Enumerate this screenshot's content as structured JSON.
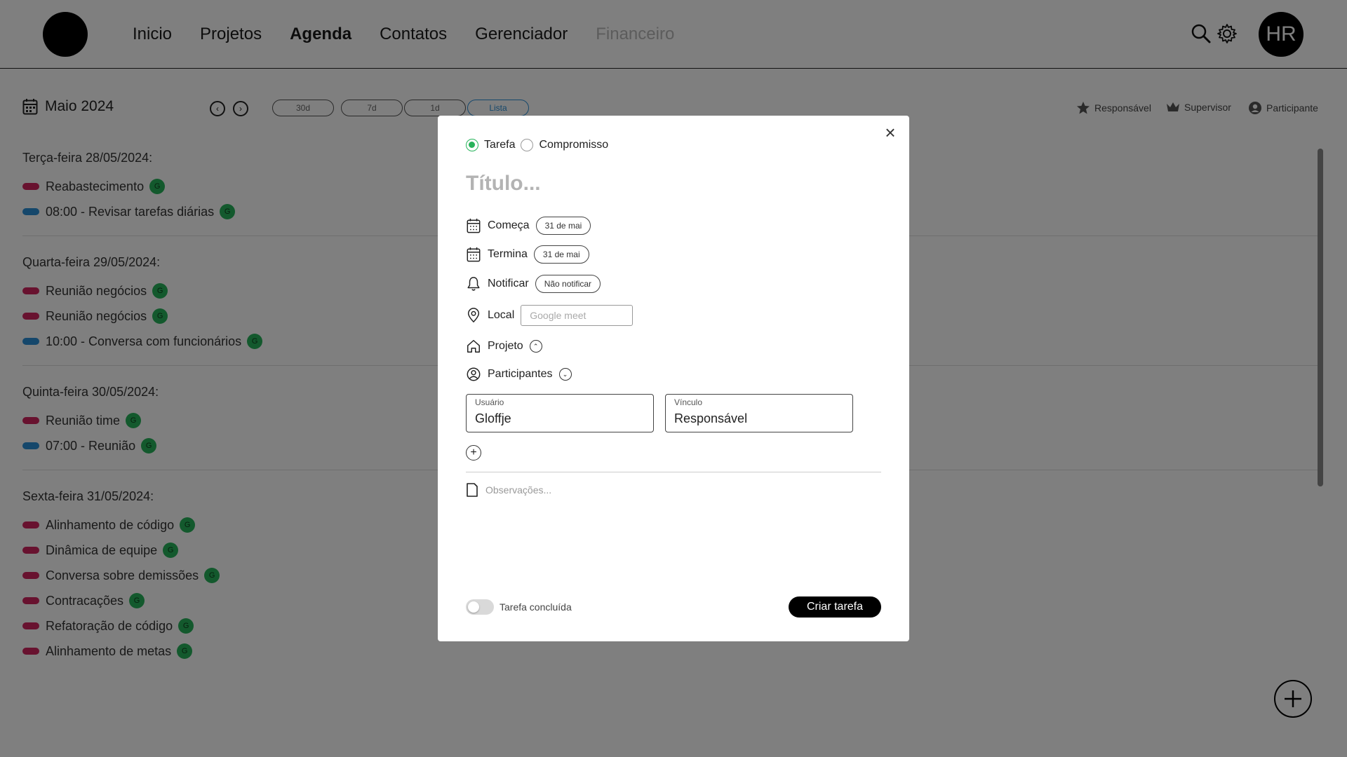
{
  "header": {
    "nav": [
      "Inicio",
      "Projetos",
      "Agenda",
      "Contatos",
      "Gerenciador",
      "Financeiro"
    ],
    "active_nav": "Agenda",
    "disabled_nav": "Financeiro",
    "avatar_initials": "HR",
    "icons": [
      "search-icon",
      "gear-icon"
    ]
  },
  "toolbar": {
    "month": "Maio 2024",
    "views": [
      "30d",
      "7d",
      "1d",
      "Lista"
    ],
    "selected_view": "Lista",
    "legend": [
      "Responsável",
      "Supervisor",
      "Participante"
    ]
  },
  "days": [
    {
      "title": "Terça-feira 28/05/2024:",
      "events": [
        {
          "label": "Reabastecimento",
          "color": "red",
          "badge": "G"
        },
        {
          "label": "08:00 - Revisar tarefas diárias",
          "color": "blue",
          "badge": "G"
        }
      ]
    },
    {
      "title": "Quarta-feira 29/05/2024:",
      "events": [
        {
          "label": "Reunião negócios",
          "color": "red",
          "badge": "G"
        },
        {
          "label": "Reunião negócios",
          "color": "red",
          "badge": "G"
        },
        {
          "label": "10:00 - Conversa com funcionários",
          "color": "blue",
          "badge": "G"
        }
      ]
    },
    {
      "title": "Quinta-feira 30/05/2024:",
      "events": [
        {
          "label": "Reunião time",
          "color": "red",
          "badge": "G"
        },
        {
          "label": "07:00 - Reunião",
          "color": "blue",
          "badge": "G"
        }
      ]
    },
    {
      "title": "Sexta-feira 31/05/2024:",
      "events": [
        {
          "label": "Alinhamento de código",
          "color": "red",
          "badge": "G"
        },
        {
          "label": "Dinâmica de equipe",
          "color": "red",
          "badge": "G"
        },
        {
          "label": "Conversa sobre demissões",
          "color": "red",
          "badge": "G"
        },
        {
          "label": "Contracações",
          "color": "red",
          "badge": "G"
        },
        {
          "label": "Refatoração de código",
          "color": "red",
          "badge": "G"
        },
        {
          "label": "Alinhamento de metas",
          "color": "red",
          "badge": "G"
        }
      ]
    }
  ],
  "colors": {
    "red": "#d1245f",
    "blue": "#2a8fd6",
    "badge": "#27b35a",
    "accent": "#2a8fd6"
  },
  "modal": {
    "type_options": [
      "Tarefa",
      "Compromisso"
    ],
    "selected_type": "Tarefa",
    "title_placeholder": "Título...",
    "starts_label": "Começa",
    "starts_value": "31 de mai",
    "ends_label": "Termina",
    "ends_value": "31 de mai",
    "notify_label": "Notificar",
    "notify_value": "Não notificar",
    "local_label": "Local",
    "local_placeholder": "Google meet",
    "project_label": "Projeto",
    "participants_label": "Participantes",
    "user_label": "Usuário",
    "user_value": "Gloffje",
    "link_label": "Vínculo",
    "link_value": "Responsável",
    "notes_placeholder": "Observações...",
    "done_label": "Tarefa concluída",
    "done": false,
    "submit_label": "Criar tarefa"
  }
}
